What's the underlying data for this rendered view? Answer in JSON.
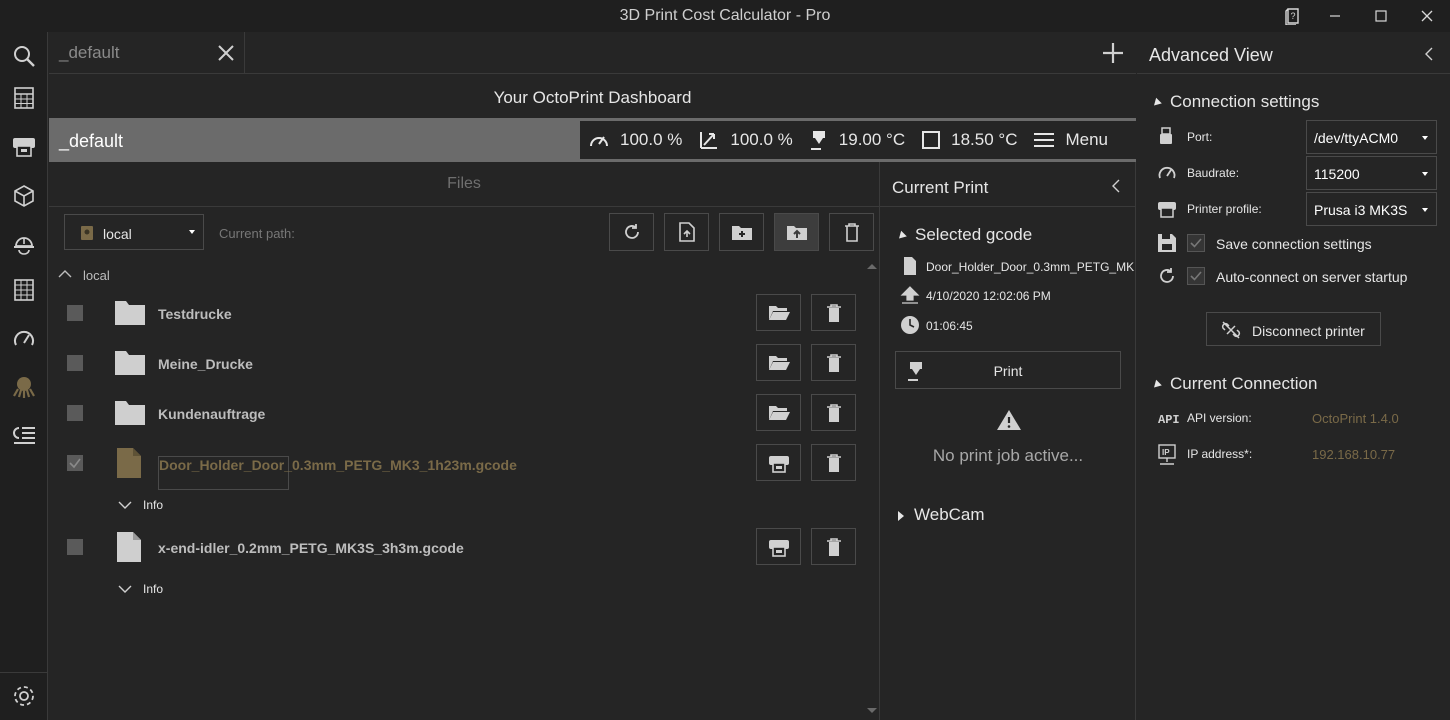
{
  "window": {
    "title": "3D Print Cost Calculator - Pro"
  },
  "tabs": [
    {
      "label": "_default"
    }
  ],
  "dashboard": {
    "title": "Your OctoPrint Dashboard",
    "profile": "_default",
    "stats": {
      "speed": "100.0 %",
      "flow": "100.0 %",
      "nozzle_temp": "19.00 °C",
      "bed_temp": "18.50 °C",
      "menu": "Menu"
    }
  },
  "files": {
    "header": "Files",
    "storage": "local",
    "current_path_label": "Current path:",
    "tree_root": "local",
    "items": [
      {
        "name": "Testdrucke",
        "type": "folder",
        "checked": false
      },
      {
        "name": "Meine_Drucke",
        "type": "folder",
        "checked": false
      },
      {
        "name": "Kundenauftrage",
        "type": "folder",
        "checked": false
      },
      {
        "name": "Door_Holder_Door_0.3mm_PETG_MK3_1h23m.gcode",
        "type": "gcode",
        "checked": true,
        "info": "Info"
      },
      {
        "name": "x-end-idler_0.2mm_PETG_MK3S_3h3m.gcode",
        "type": "gcode",
        "checked": false,
        "info": "Info"
      }
    ]
  },
  "current_print": {
    "header": "Current Print",
    "selected_section": "Selected gcode",
    "filename": "Door_Holder_Door_0.3mm_PETG_MK",
    "uploaded": "4/10/2020 12:02:06 PM",
    "duration": "01:06:45",
    "print_label": "Print",
    "no_job": "No print job active...",
    "webcam_section": "WebCam"
  },
  "advanced": {
    "header": "Advanced View",
    "connection_section": "Connection settings",
    "port_label": "Port:",
    "port_value": "/dev/ttyACM0",
    "baud_label": "Baudrate:",
    "baud_value": "115200",
    "profile_label": "Printer profile:",
    "profile_value": "Prusa i3 MK3S",
    "save_label": "Save connection settings",
    "autoconnect_label": "Auto-connect on server startup",
    "disconnect_label": "Disconnect printer",
    "current_section": "Current Connection",
    "api_label": "API version:",
    "api_value": "OctoPrint 1.4.0",
    "ip_label": "IP address*:",
    "ip_value": "192.168.10.77"
  },
  "colors": {
    "accent": "#7a6a48",
    "background": "#252525",
    "status_bar": "#6b6b6b"
  }
}
